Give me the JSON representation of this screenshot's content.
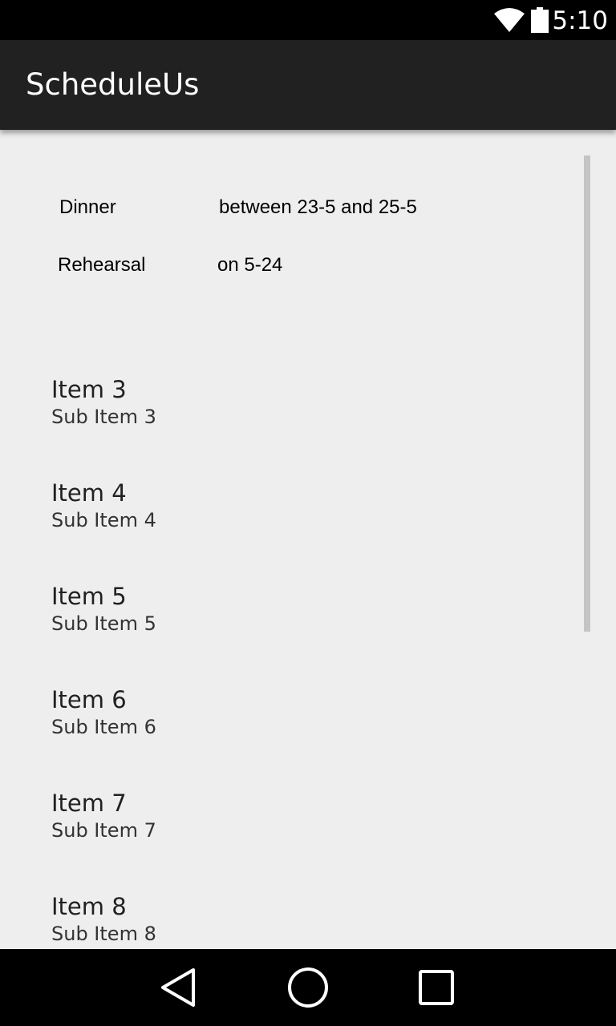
{
  "status_bar": {
    "time": "5:10",
    "icons": [
      "wifi-icon",
      "battery-icon"
    ]
  },
  "app_bar": {
    "title": "ScheduleUs"
  },
  "events": [
    {
      "name": "Dinner",
      "detail": "between 23-5 and 25-5"
    },
    {
      "name": "Rehearsal",
      "detail": "on 5-24"
    }
  ],
  "items": [
    {
      "title": "Item 3",
      "subtitle": "Sub Item 3"
    },
    {
      "title": "Item 4",
      "subtitle": "Sub Item 4"
    },
    {
      "title": "Item 5",
      "subtitle": "Sub Item 5"
    },
    {
      "title": "Item 6",
      "subtitle": "Sub Item 6"
    },
    {
      "title": "Item 7",
      "subtitle": "Sub Item 7"
    },
    {
      "title": "Item 8",
      "subtitle": "Sub Item 8"
    }
  ],
  "nav_bar": {
    "icons": [
      "back-icon",
      "home-icon",
      "recents-icon"
    ]
  },
  "colors": {
    "status_bar": "#000000",
    "app_bar": "#212121",
    "background": "#eeeeee",
    "nav_bar": "#000000"
  }
}
